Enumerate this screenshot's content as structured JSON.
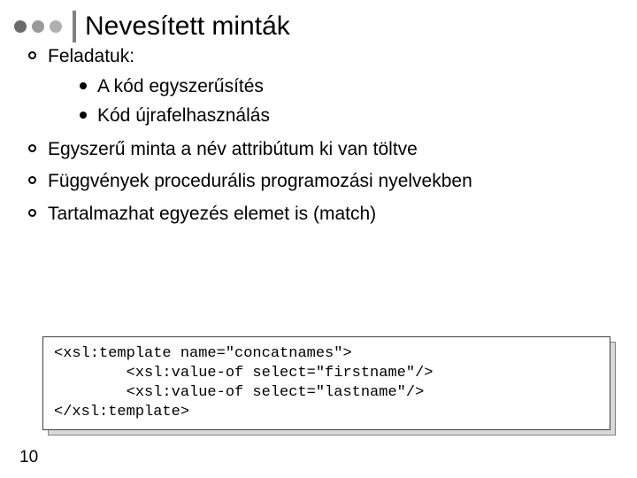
{
  "title": "Nevesített minták",
  "bullets": {
    "b0": "Feladatuk:",
    "b0_sub0": "A kód egyszerűsítés",
    "b0_sub1": "Kód újrafelhasználás",
    "b1": "Egyszerű minta a név attribútum ki van töltve",
    "b2": "Függvények procedurális programozási nyelvekben",
    "b3": "Tartalmazhat egyezés elemet is (match)"
  },
  "code": "<xsl:template name=\"concatnames\">\n        <xsl:value-of select=\"firstname\"/>\n        <xsl:value-of select=\"lastname\"/>\n</xsl:template>",
  "page_number": "10"
}
